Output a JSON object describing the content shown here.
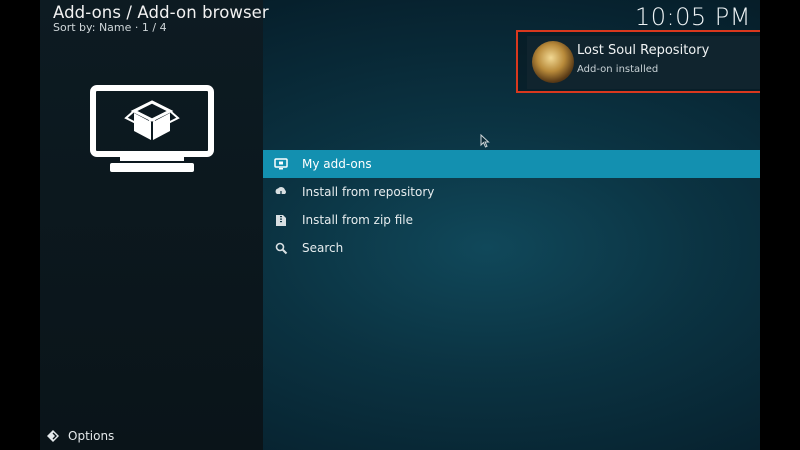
{
  "header": {
    "title": "Add-ons / Add-on browser",
    "subtitle": "Sort by: Name  ·  1 / 4",
    "clock": "10:05 PM"
  },
  "left_panel": {
    "icon": "addon-box-tv-icon"
  },
  "menu": {
    "items": [
      {
        "label": "My add-ons",
        "icon": "monitor-icon",
        "selected": true
      },
      {
        "label": "Install from repository",
        "icon": "cloud-download-icon",
        "selected": false
      },
      {
        "label": "Install from zip file",
        "icon": "zip-file-icon",
        "selected": false
      },
      {
        "label": "Search",
        "icon": "search-icon",
        "selected": false
      }
    ]
  },
  "notification": {
    "title": "Lost Soul Repository",
    "subtitle": "Add-on installed",
    "highlight_color": "#d9381e"
  },
  "footer": {
    "options_label": "Options",
    "options_icon": "diamond-arrows-icon"
  },
  "colors": {
    "accent": "#1390b0",
    "background": "#072330"
  }
}
